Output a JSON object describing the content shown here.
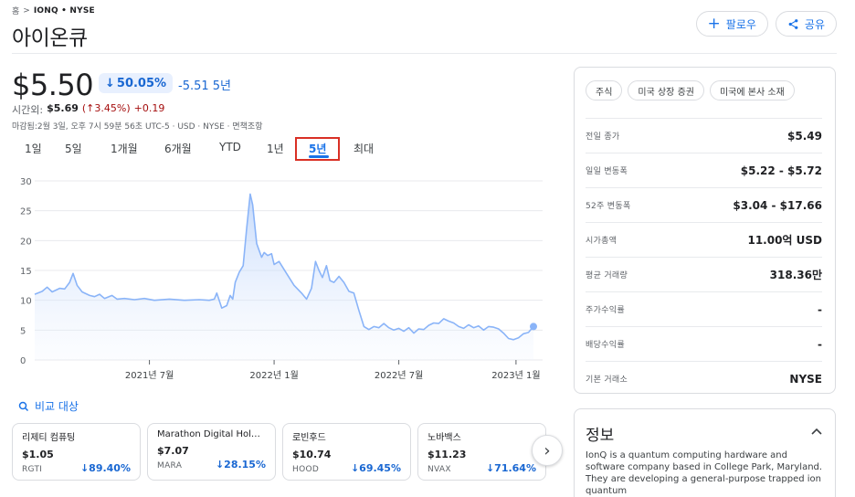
{
  "breadcrumb": {
    "home": "홈",
    "sep": ">",
    "symbol": "IONQ • NYSE"
  },
  "title": "아이온큐",
  "actions": {
    "follow": "팔로우",
    "share": "공유"
  },
  "price": {
    "current": "$5.50",
    "change_pct": "50.05%",
    "change_abs": "-5.51 5년",
    "afterhours_label": "시간외:",
    "afterhours_price": "$5.69",
    "afterhours_pct": "(↑3.45%)",
    "afterhours_abs": "+0.19",
    "closed_note": "마감됨:2월 3일, 오후 7시 59분 56초 UTC-5 · USD · NYSE · 면책조항"
  },
  "range_tabs": [
    "1일",
    "5일",
    "1개월",
    "6개월",
    "YTD",
    "1년",
    "5년",
    "최대"
  ],
  "active_range": "5년",
  "chart_data": {
    "type": "area",
    "ylim": [
      0,
      30
    ],
    "yticks": [
      "0",
      "5",
      "10",
      "15",
      "20",
      "25",
      "30"
    ],
    "xtick_labels": [
      "2021년 7월",
      "2022년 1월",
      "2022년 7월",
      "2023년 1월"
    ],
    "xtick_positions": [
      0.23,
      0.48,
      0.73,
      0.965
    ],
    "series": [
      {
        "points": [
          [
            0.0,
            11
          ],
          [
            0.015,
            11.5
          ],
          [
            0.025,
            12.2
          ],
          [
            0.035,
            11.4
          ],
          [
            0.05,
            12
          ],
          [
            0.06,
            11.9
          ],
          [
            0.07,
            13
          ],
          [
            0.077,
            14.5
          ],
          [
            0.085,
            12.5
          ],
          [
            0.095,
            11.4
          ],
          [
            0.11,
            10.8
          ],
          [
            0.12,
            10.6
          ],
          [
            0.13,
            11
          ],
          [
            0.14,
            10.3
          ],
          [
            0.155,
            10.8
          ],
          [
            0.165,
            10.2
          ],
          [
            0.18,
            10.3
          ],
          [
            0.2,
            10.1
          ],
          [
            0.22,
            10.3
          ],
          [
            0.24,
            10.0
          ],
          [
            0.27,
            10.2
          ],
          [
            0.3,
            10.0
          ],
          [
            0.33,
            10.1
          ],
          [
            0.35,
            10.0
          ],
          [
            0.36,
            10.2
          ],
          [
            0.365,
            11.2
          ],
          [
            0.375,
            8.7
          ],
          [
            0.385,
            9.1
          ],
          [
            0.392,
            10.8
          ],
          [
            0.397,
            10.2
          ],
          [
            0.402,
            13
          ],
          [
            0.41,
            14.7
          ],
          [
            0.418,
            15.8
          ],
          [
            0.425,
            22
          ],
          [
            0.432,
            27.8
          ],
          [
            0.437,
            26
          ],
          [
            0.445,
            19.5
          ],
          [
            0.455,
            17.2
          ],
          [
            0.46,
            18
          ],
          [
            0.467,
            17.5
          ],
          [
            0.475,
            17.8
          ],
          [
            0.48,
            16
          ],
          [
            0.49,
            16.5
          ],
          [
            0.505,
            14.5
          ],
          [
            0.52,
            12.5
          ],
          [
            0.535,
            11.2
          ],
          [
            0.545,
            10.2
          ],
          [
            0.555,
            12
          ],
          [
            0.563,
            16.5
          ],
          [
            0.57,
            15
          ],
          [
            0.577,
            13.8
          ],
          [
            0.585,
            15.8
          ],
          [
            0.592,
            13.3
          ],
          [
            0.6,
            13
          ],
          [
            0.61,
            14
          ],
          [
            0.62,
            13
          ],
          [
            0.63,
            11.5
          ],
          [
            0.64,
            11.2
          ],
          [
            0.65,
            8.3
          ],
          [
            0.66,
            5.6
          ],
          [
            0.67,
            5.1
          ],
          [
            0.68,
            5.6
          ],
          [
            0.69,
            5.4
          ],
          [
            0.7,
            6.1
          ],
          [
            0.71,
            5.4
          ],
          [
            0.72,
            5.0
          ],
          [
            0.73,
            5.3
          ],
          [
            0.74,
            4.8
          ],
          [
            0.75,
            5.4
          ],
          [
            0.76,
            4.5
          ],
          [
            0.77,
            5.2
          ],
          [
            0.78,
            5.1
          ],
          [
            0.79,
            5.8
          ],
          [
            0.8,
            6.2
          ],
          [
            0.81,
            6.1
          ],
          [
            0.82,
            6.9
          ],
          [
            0.83,
            6.5
          ],
          [
            0.84,
            6.2
          ],
          [
            0.85,
            5.6
          ],
          [
            0.86,
            5.3
          ],
          [
            0.87,
            5.9
          ],
          [
            0.88,
            5.4
          ],
          [
            0.89,
            5.7
          ],
          [
            0.9,
            5.0
          ],
          [
            0.91,
            5.6
          ],
          [
            0.92,
            5.5
          ],
          [
            0.93,
            5.2
          ],
          [
            0.94,
            4.5
          ],
          [
            0.95,
            3.6
          ],
          [
            0.96,
            3.4
          ],
          [
            0.97,
            3.7
          ],
          [
            0.98,
            4.4
          ],
          [
            0.99,
            4.6
          ],
          [
            1.0,
            5.6
          ]
        ]
      }
    ]
  },
  "compare": {
    "link_label": "비교 대상",
    "cards": [
      {
        "name": "리제티 컴퓨팅",
        "price": "$1.05",
        "ticker": "RGTI",
        "change": "89.40%"
      },
      {
        "name": "Marathon Digital Holdi...",
        "price": "$7.07",
        "ticker": "MARA",
        "change": "28.15%"
      },
      {
        "name": "로빈후드",
        "price": "$10.74",
        "ticker": "HOOD",
        "change": "69.45%"
      },
      {
        "name": "노바백스",
        "price": "$11.23",
        "ticker": "NVAX",
        "change": "71.64%"
      }
    ]
  },
  "tags": [
    "주식",
    "미국 상장 증권",
    "미국에 본사 소재"
  ],
  "stats": [
    {
      "label": "전일 종가",
      "value": "$5.49"
    },
    {
      "label": "일일 변동폭",
      "value": "$5.22 - $5.72"
    },
    {
      "label": "52주 변동폭",
      "value": "$3.04 - $17.66"
    },
    {
      "label": "시가총액",
      "value": "11.00억 USD"
    },
    {
      "label": "평균 거래량",
      "value": "318.36만"
    },
    {
      "label": "주가수익률",
      "value": "-"
    },
    {
      "label": "배당수익률",
      "value": "-"
    },
    {
      "label": "기본 거래소",
      "value": "NYSE"
    }
  ],
  "about": {
    "title": "정보",
    "text": "IonQ is a quantum computing hardware and software company based in College Park, Maryland. They are developing a general-purpose trapped ion quantum"
  },
  "colors": {
    "accent": "#1a73e8",
    "down": "#1967d2",
    "highlight": "#d93025"
  }
}
